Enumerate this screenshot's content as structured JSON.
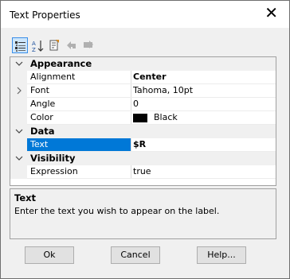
{
  "window": {
    "title": "Text Properties",
    "close_label": "✕"
  },
  "toolbar": {
    "buttons": [
      {
        "name": "categorized-view",
        "active": true
      },
      {
        "name": "alphabetical-sort",
        "active": false
      },
      {
        "name": "property-pages",
        "active": false
      },
      {
        "name": "back",
        "active": false
      },
      {
        "name": "forward",
        "active": false
      }
    ]
  },
  "grid": {
    "categories": [
      {
        "name": "Appearance",
        "properties": [
          {
            "label": "Alignment",
            "value": "Center",
            "bold": true
          },
          {
            "label": "Font",
            "value": "Tahoma, 10pt",
            "expandable": true
          },
          {
            "label": "Angle",
            "value": "0"
          },
          {
            "label": "Color",
            "value": "Black",
            "swatch": "#000000"
          }
        ]
      },
      {
        "name": "Data",
        "properties": [
          {
            "label": "Text",
            "value": "$R",
            "bold": true,
            "selected": true
          }
        ]
      },
      {
        "name": "Visibility",
        "properties": [
          {
            "label": "Expression",
            "value": "true"
          }
        ]
      }
    ]
  },
  "description": {
    "title": "Text",
    "text": "Enter the text you wish to appear on the label."
  },
  "buttons": {
    "ok": "Ok",
    "cancel": "Cancel",
    "help": "Help..."
  },
  "colors": {
    "selection": "#0078d7",
    "toolbar_active": "#cde6fb"
  }
}
